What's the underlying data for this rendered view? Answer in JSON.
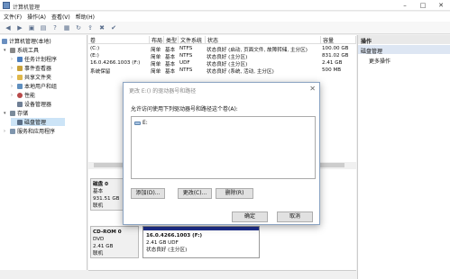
{
  "window": {
    "title": "计算机管理"
  },
  "menu": [
    "文件(F)",
    "操作(A)",
    "查看(V)",
    "帮助(H)"
  ],
  "tree": {
    "items": [
      {
        "label": "计算机管理(本地)",
        "level": 0,
        "expander": ""
      },
      {
        "label": "系统工具",
        "level": 1,
        "expander": "▾"
      },
      {
        "label": "任务计划程序",
        "level": 2,
        "expander": "›"
      },
      {
        "label": "事件查看器",
        "level": 2,
        "expander": "›"
      },
      {
        "label": "共享文件夹",
        "level": 2,
        "expander": "›"
      },
      {
        "label": "本地用户和组",
        "level": 2,
        "expander": "›"
      },
      {
        "label": "性能",
        "level": 2,
        "expander": "›"
      },
      {
        "label": "设备管理器",
        "level": 2,
        "expander": ""
      },
      {
        "label": "存储",
        "level": 1,
        "expander": "▾"
      },
      {
        "label": "磁盘管理",
        "level": 2,
        "expander": ""
      },
      {
        "label": "服务和应用程序",
        "level": 1,
        "expander": "›"
      }
    ]
  },
  "volumes": {
    "headers": [
      "卷",
      "布局",
      "类型",
      "文件系统",
      "状态",
      "容量"
    ],
    "rows": [
      {
        "name": "(C:)",
        "layout": "简单",
        "type": "基本",
        "fs": "NTFS",
        "status": "状态良好 (启动, 页面文件, 故障转储, 主分区)",
        "capacity": "100.00 GB"
      },
      {
        "name": "(E:)",
        "layout": "简单",
        "type": "基本",
        "fs": "NTFS",
        "status": "状态良好 (主分区)",
        "capacity": "831.02 GB"
      },
      {
        "name": "16.0.4266.1003 (F:)",
        "layout": "简单",
        "type": "基本",
        "fs": "UDF",
        "status": "状态良好 (主分区)",
        "capacity": "2.41 GB"
      },
      {
        "name": "系统保留",
        "layout": "简单",
        "type": "基本",
        "fs": "NTFS",
        "status": "状态良好 (系统, 活动, 主分区)",
        "capacity": "500 MB"
      }
    ]
  },
  "disk0": {
    "name": "磁盘 0",
    "type": "基本",
    "size": "931.51 GB",
    "state": "联机"
  },
  "cdrom": {
    "name": "CD-ROM 0",
    "type": "DVD",
    "size": "2.41 GB",
    "state": "联机",
    "part_name": "16.0.4266.1003  (F:)",
    "part_size": "2.41 GB UDF",
    "part_status": "状态良好 (主分区)"
  },
  "actions": {
    "header": "操作",
    "section": "磁盘管理",
    "more": "更多操作"
  },
  "dialog": {
    "title": "更改 E:() 的驱动器号和路径",
    "prompt": "允许访问使用下列驱动器号和路径这个卷(A):",
    "list_item": "E:",
    "add": "添加(D)...",
    "change": "更改(C)...",
    "remove": "删除(R)",
    "ok": "确定",
    "cancel": "取消"
  },
  "colors": {
    "accent": "#1e2f8f",
    "selection": "#cce4f7",
    "action_section": "#dde6f3"
  }
}
